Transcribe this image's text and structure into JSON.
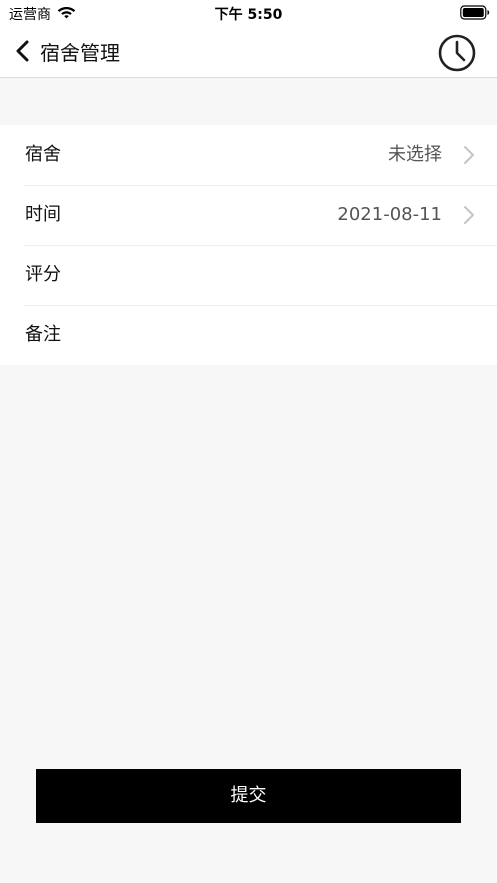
{
  "status_bar": {
    "carrier": "运营商",
    "time": "下午 5:50",
    "icons": [
      "wifi-icon",
      "battery-icon"
    ]
  },
  "nav": {
    "back_icon": "chevron-left-icon",
    "title": "宿舍管理",
    "history_icon": "clock-icon"
  },
  "form": {
    "rows": [
      {
        "label": "宿舍",
        "value": "未选择",
        "has_chevron": true
      },
      {
        "label": "时间",
        "value": "2021-08-11",
        "has_chevron": true
      },
      {
        "label": "评分",
        "value": "",
        "has_chevron": false
      },
      {
        "label": "备注",
        "value": "",
        "has_chevron": false
      }
    ]
  },
  "submit": {
    "label": "提交"
  },
  "colors": {
    "background": "#f7f7f7",
    "card": "#ffffff",
    "button": "#000000",
    "button_text": "#ffffff",
    "value_text": "#555555",
    "chevron": "#c4c4c4"
  }
}
